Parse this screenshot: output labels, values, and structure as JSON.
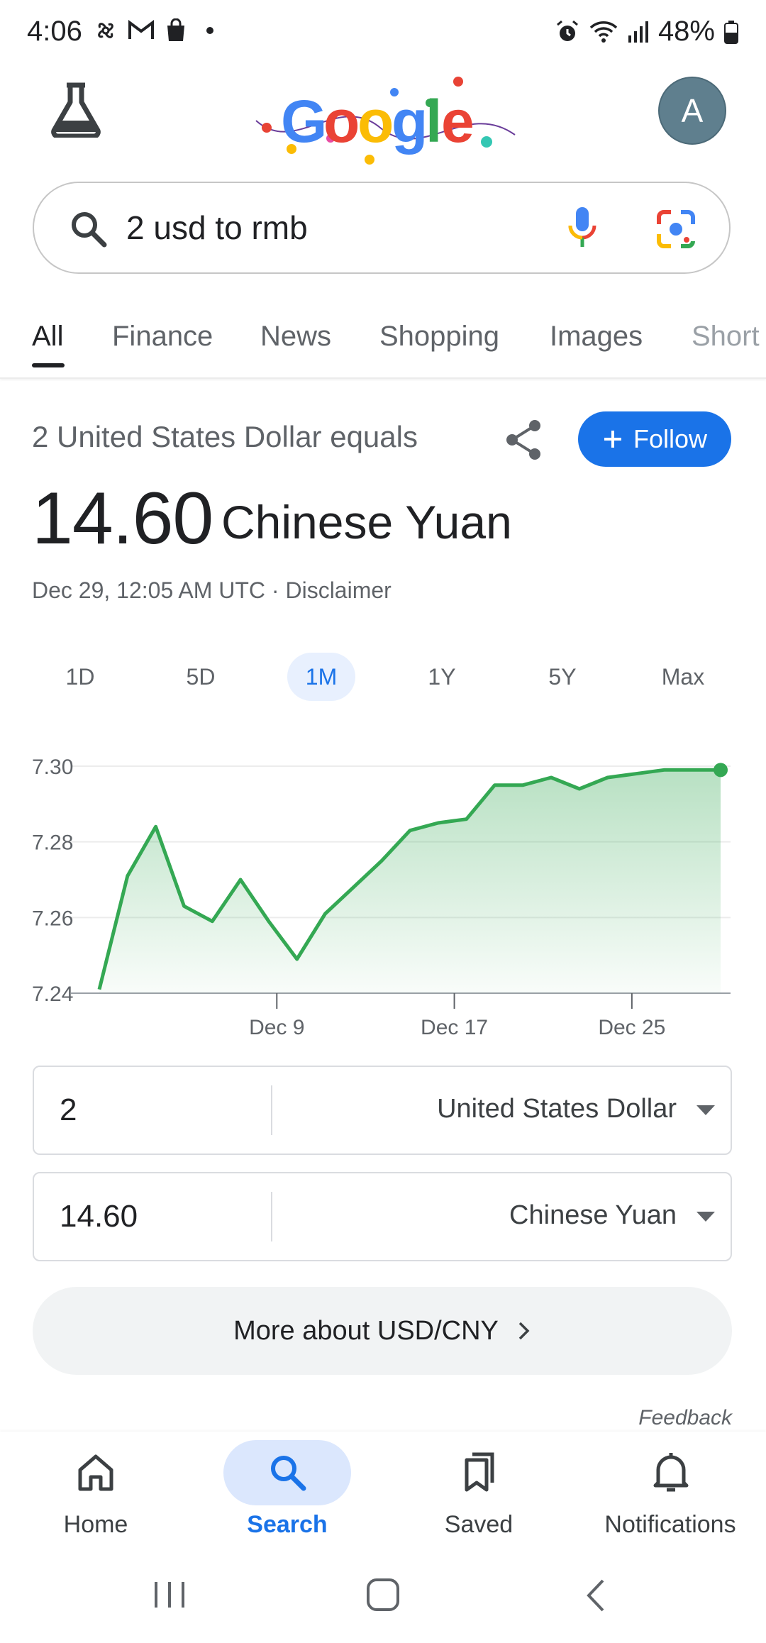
{
  "status_bar": {
    "time": "4:06",
    "battery": "48%"
  },
  "avatar_letter": "A",
  "search": {
    "query": "2 usd to rmb"
  },
  "tabs": [
    "All",
    "Finance",
    "News",
    "Shopping",
    "Images",
    "Short"
  ],
  "result": {
    "equals_text": "2 United States Dollar equals",
    "value": "14.60",
    "currency": "Chinese Yuan",
    "follow_label": "Follow",
    "timestamp": "Dec 29, 12:05 AM UTC · Disclaimer"
  },
  "ranges": [
    "1D",
    "5D",
    "1M",
    "1Y",
    "5Y",
    "Max"
  ],
  "chart_data": {
    "type": "area",
    "y_ticks": [
      "7.30",
      "7.28",
      "7.26",
      "7.24"
    ],
    "x_ticks": [
      "Dec 9",
      "Dec 17",
      "Dec 25"
    ],
    "ylim": [
      7.24,
      7.3
    ],
    "x": [
      0,
      1,
      2,
      3,
      4,
      5,
      6,
      7,
      8,
      9,
      10,
      11,
      12,
      13,
      14,
      15,
      16,
      17,
      18,
      19,
      20,
      21,
      22
    ],
    "values": [
      7.241,
      7.271,
      7.284,
      7.263,
      7.259,
      7.27,
      7.259,
      7.249,
      7.261,
      7.268,
      7.275,
      7.283,
      7.285,
      7.286,
      7.295,
      7.295,
      7.297,
      7.294,
      7.297,
      7.298,
      7.299,
      7.299,
      7.299
    ],
    "color": "#34a853"
  },
  "converter": {
    "from_value": "2",
    "from_currency": "United States Dollar",
    "to_value": "14.60",
    "to_currency": "Chinese Yuan"
  },
  "more_label": "More about USD/CNY",
  "feedback_label": "Feedback",
  "bottom_nav": [
    "Home",
    "Search",
    "Saved",
    "Notifications"
  ]
}
